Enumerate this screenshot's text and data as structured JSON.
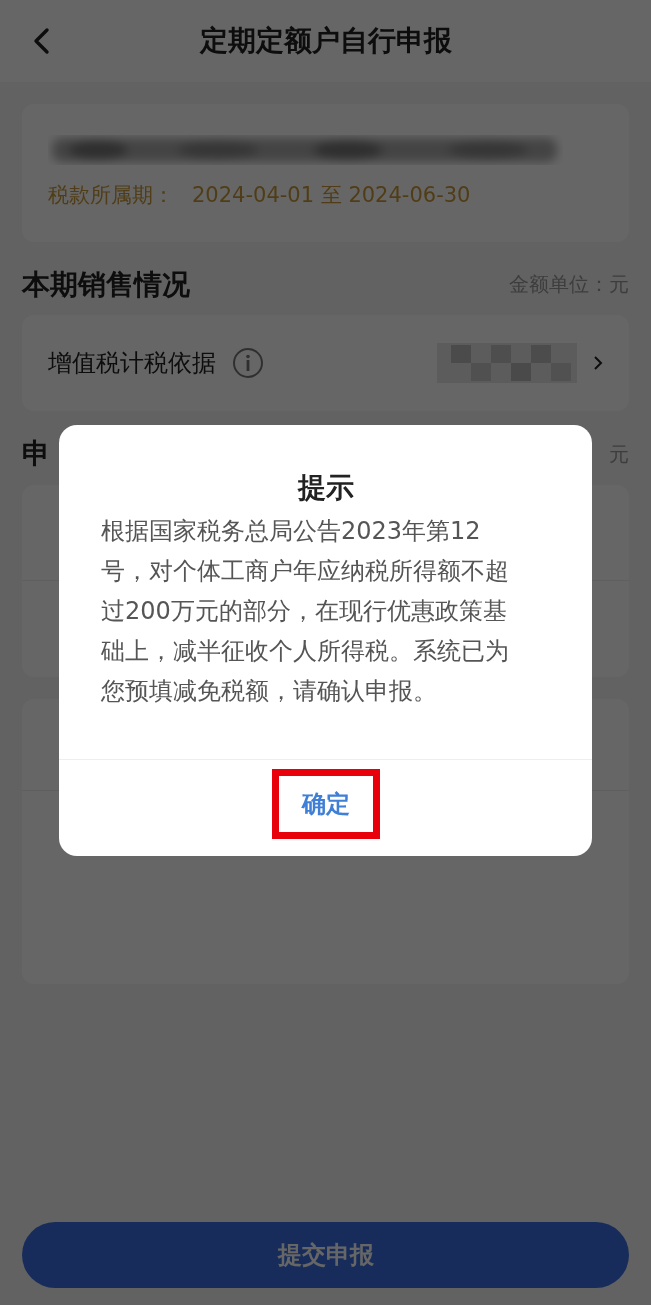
{
  "header": {
    "title": "定期定额户自行申报"
  },
  "period_card": {
    "label": "税款所属期：",
    "value": "2024-04-01 至 2024-06-30"
  },
  "sales_section": {
    "title": "本期销售情况",
    "unit": "金额单位：元",
    "rows": [
      {
        "label": "增值税计税依据"
      }
    ]
  },
  "declaration_section": {
    "title_visible": "申",
    "unit_visible": "元"
  },
  "submit_button": {
    "label": "提交申报"
  },
  "dialog": {
    "title": "提示",
    "message": "根据国家税务总局公告2023年第12号，对个体工商户年应纳税所得额不超过200万元的部分，在现行优惠政策基础上，减半征收个人所得税。系统已为您预填减免税额，请确认申报。",
    "confirm": "确定",
    "highlighted": true
  }
}
